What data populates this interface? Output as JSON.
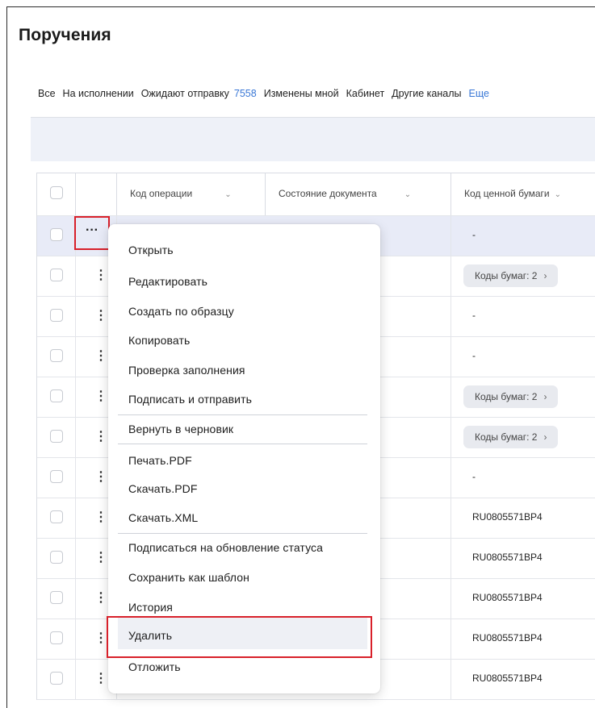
{
  "page": {
    "title": "Поручения"
  },
  "tabs": [
    {
      "label": "Все"
    },
    {
      "label": "На исполнении"
    },
    {
      "label": "Ожидают отправку",
      "count": "7558"
    },
    {
      "label": "Изменены мной"
    },
    {
      "label": "Кабинет"
    },
    {
      "label": "Другие каналы"
    },
    {
      "label": "Еще"
    }
  ],
  "table": {
    "columns": [
      {
        "label": "Код операции",
        "chevron": "⌄"
      },
      {
        "label": "Состояние документа",
        "chevron": "⌄"
      },
      {
        "label": "Код ценной бумаги",
        "chevron": "⌄"
      }
    ],
    "rows": [
      {
        "security_code": "-"
      },
      {
        "security_code": "Коды бумаг: 2",
        "pill": true
      },
      {
        "security_code": "-"
      },
      {
        "security_code": "-"
      },
      {
        "security_code": "Коды бумаг: 2",
        "pill": true
      },
      {
        "security_code": "Коды бумаг: 2",
        "pill": true
      },
      {
        "security_code": "-"
      },
      {
        "security_code": "RU0805571BP4"
      },
      {
        "security_code": "RU0805571BP4"
      },
      {
        "security_code": "RU0805571BP4"
      },
      {
        "security_code": "RU0805571BP4"
      },
      {
        "security_code": "RU0805571BP4"
      }
    ]
  },
  "row_actions_glyph": "···",
  "kebab_glyph": "⋮",
  "pill_arrow": "›",
  "context_menu": {
    "items": [
      {
        "label": "Открыть"
      },
      {
        "label": "Редактировать"
      },
      {
        "label": "Создать по образцу"
      },
      {
        "label": "Копировать"
      },
      {
        "label": "Проверка заполнения"
      },
      {
        "label": "Подписать и отправить"
      },
      {
        "label": "Вернуть в черновик"
      },
      {
        "label": "Печать.PDF"
      },
      {
        "label": "Скачать.PDF"
      },
      {
        "label": "Скачать.XML"
      },
      {
        "label": "Подписаться на обновление статуса"
      },
      {
        "label": "Сохранить как шаблон"
      },
      {
        "label": "История"
      },
      {
        "label": "Удалить"
      },
      {
        "label": "Отложить"
      }
    ]
  },
  "colors": {
    "accent": "#3a78d6",
    "highlight_border": "#d8202a",
    "selected_row": "#e8ebf7"
  }
}
